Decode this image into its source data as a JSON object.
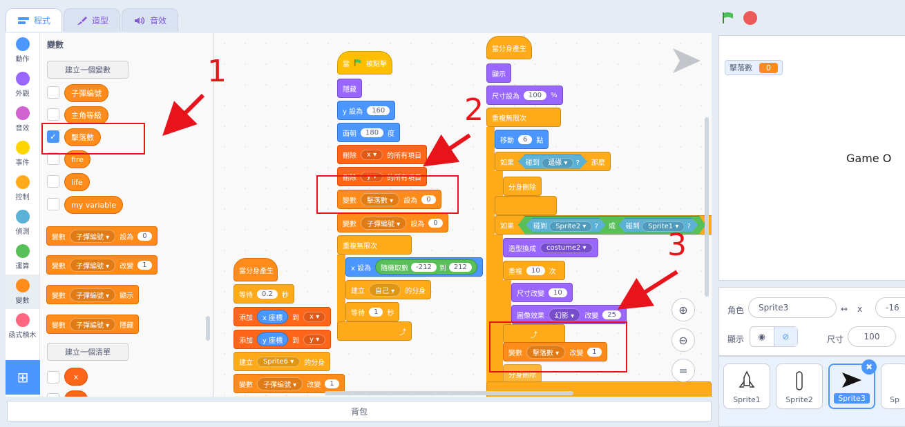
{
  "tabs": {
    "code": "程式",
    "costumes": "造型",
    "sounds": "音效"
  },
  "categories": [
    {
      "label": "動作",
      "color": "#4c97ff"
    },
    {
      "label": "外觀",
      "color": "#9966ff"
    },
    {
      "label": "音效",
      "color": "#cf63cf"
    },
    {
      "label": "事件",
      "color": "#ffd500"
    },
    {
      "label": "控制",
      "color": "#ffab19"
    },
    {
      "label": "偵測",
      "color": "#5cb1d6"
    },
    {
      "label": "運算",
      "color": "#59c059"
    },
    {
      "label": "變數",
      "color": "#ff8c1a"
    },
    {
      "label": "函式積木",
      "color": "#ff6680"
    }
  ],
  "palette": {
    "title": "變數",
    "make_variable": "建立一個變數",
    "make_list": "建立一個清單",
    "variables": [
      "子彈編號",
      "主角等級",
      "擊落數",
      "fire",
      "life",
      "my variable"
    ],
    "list_item": "x",
    "set_block": {
      "prefix": "變數",
      "var": "子彈編號",
      "op": "設為",
      "value": "0"
    },
    "change_block": {
      "prefix": "變數",
      "var": "子彈編號",
      "op": "改變",
      "value": "1"
    },
    "show_block": {
      "prefix": "變數",
      "var": "子彈編號",
      "op": "顯示"
    },
    "hide_block": {
      "prefix": "變數",
      "var": "子彈編號",
      "op": "隱藏"
    }
  },
  "script_a": {
    "hat": "當分身產生",
    "wait": "等待",
    "wait_val": "0.2",
    "sec": "秒",
    "add1": "添加",
    "add1_val": "x 座標",
    "to": "到",
    "list1": "x",
    "add2": "添加",
    "add2_val": "y 座標",
    "list2": "y",
    "create": "建立",
    "create_val": "Sprite6",
    "create_suffix": "的分身",
    "chg": "變數",
    "chg_var": "子彈編號",
    "chg_op": "改變",
    "chg_val": "1"
  },
  "script_b": {
    "hat": "當",
    "hat2": "被點擊",
    "hide": "隱藏",
    "sety": "y 設為",
    "sety_val": "160",
    "dir": "面朝",
    "dir_val": "180",
    "dir_unit": "度",
    "del1": "刪除",
    "del1_list": "x",
    "del1_suffix": "的所有項目",
    "del2": "刪除",
    "del2_list": "y",
    "del2_suffix": "的所有項目",
    "set1": "變數",
    "set1_var": "擊落數",
    "set1_op": "設為",
    "set1_val": "0",
    "set2": "變數",
    "set2_var": "子彈編號",
    "set2_op": "設為",
    "set2_val": "0",
    "forever": "重複無限次",
    "setx": "x 設為",
    "rand": "隨機取數",
    "rand_a": "-212",
    "rand_to": "到",
    "rand_b": "212",
    "clone": "建立",
    "clone_val": "自己",
    "clone_suffix": "的分身",
    "wait": "等待",
    "wait_val": "1",
    "sec": "秒"
  },
  "script_c": {
    "hat": "當分身產生",
    "show": "顯示",
    "size": "尺寸設為",
    "size_val": "100",
    "size_unit": "%",
    "forever": "重複無限次",
    "move": "移動",
    "move_val": "6",
    "move_unit": "點",
    "if1": "如果",
    "touch": "碰到",
    "edge": "邊緣",
    "q": "?",
    "then": "那麼",
    "del_clone": "分身刪除",
    "if2": "如果",
    "touch_a": "Sprite2",
    "or": "或",
    "touch_b": "Sprite1",
    "costume": "造型換成",
    "costume_val": "costume2",
    "repeat": "重複",
    "repeat_val": "10",
    "times": "次",
    "size_chg": "尺寸改變",
    "size_chg_val": "10",
    "effect": "圖像效果",
    "effect_val": "幻影",
    "effect_op": "改變",
    "effect_amt": "25",
    "var": "變數",
    "var_name": "擊落數",
    "var_op": "改變",
    "var_val": "1",
    "del_clone2": "分身刪除"
  },
  "annotations": [
    "1",
    "2",
    "3"
  ],
  "backpack": "背包",
  "stage": {
    "monitor_label": "擊落數",
    "monitor_value": "0",
    "text": "Game O"
  },
  "sprite_info": {
    "sprite_label": "角色",
    "sprite_name": "Sprite3",
    "x_label": "x",
    "x_value": "-16",
    "show_label": "顯示",
    "size_label": "尺寸",
    "size_value": "100"
  },
  "sprites": [
    "Sprite1",
    "Sprite2",
    "Sprite3",
    "Sp"
  ]
}
